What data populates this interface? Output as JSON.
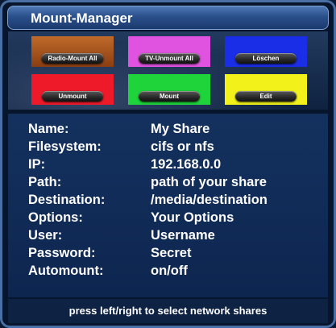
{
  "window": {
    "title": "Mount-Manager"
  },
  "buttons": [
    {
      "label": "Radio-Mount All",
      "color": "#c06a2a"
    },
    {
      "label": "TV-Unmount All",
      "color": "#e052e0"
    },
    {
      "label": "Löschen",
      "color": "#1a2ee8"
    },
    {
      "label": "Unmount",
      "color": "#ee1a2a"
    },
    {
      "label": "Mount",
      "color": "#1ed43a"
    },
    {
      "label": "Edit",
      "color": "#f2f21a"
    }
  ],
  "details": [
    {
      "label": "Name:",
      "value": "My Share"
    },
    {
      "label": "Filesystem:",
      "value": "cifs or nfs"
    },
    {
      "label": "IP:",
      "value": "192.168.0.0"
    },
    {
      "label": "Path:",
      "value": "path of your share"
    },
    {
      "label": "Destination:",
      "value": "/media/destination"
    },
    {
      "label": "Options:",
      "value": "Your Options"
    },
    {
      "label": "User:",
      "value": "Username"
    },
    {
      "label": "Password:",
      "value": "Secret"
    },
    {
      "label": "Automount:",
      "value": "on/off"
    }
  ],
  "footer": {
    "hint": "press left/right to select network shares"
  }
}
